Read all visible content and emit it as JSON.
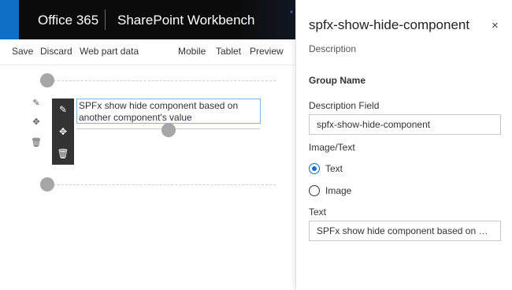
{
  "header": {
    "brand": "Office 365",
    "app": "SharePoint Workbench"
  },
  "toolbar": {
    "save": "Save",
    "discard": "Discard",
    "web_part_data": "Web part data",
    "mobile": "Mobile",
    "tablet": "Tablet",
    "preview": "Preview"
  },
  "webpart": {
    "text": "SPFx show hide component based on another component's value"
  },
  "panel": {
    "title": "spfx-show-hide-component",
    "close_icon": "×",
    "description": "Description",
    "group_name": "Group Name",
    "description_field_label": "Description Field",
    "description_field_value": "spfx-show-hide-component",
    "image_text_label": "Image/Text",
    "options": [
      {
        "label": "Text",
        "selected": true
      },
      {
        "label": "Image",
        "selected": false
      }
    ],
    "text_label": "Text",
    "text_value": "SPFx show hide component based on anot..."
  },
  "colors": {
    "accent": "#0f6fc6",
    "header_bg": "#0b0b0b"
  }
}
